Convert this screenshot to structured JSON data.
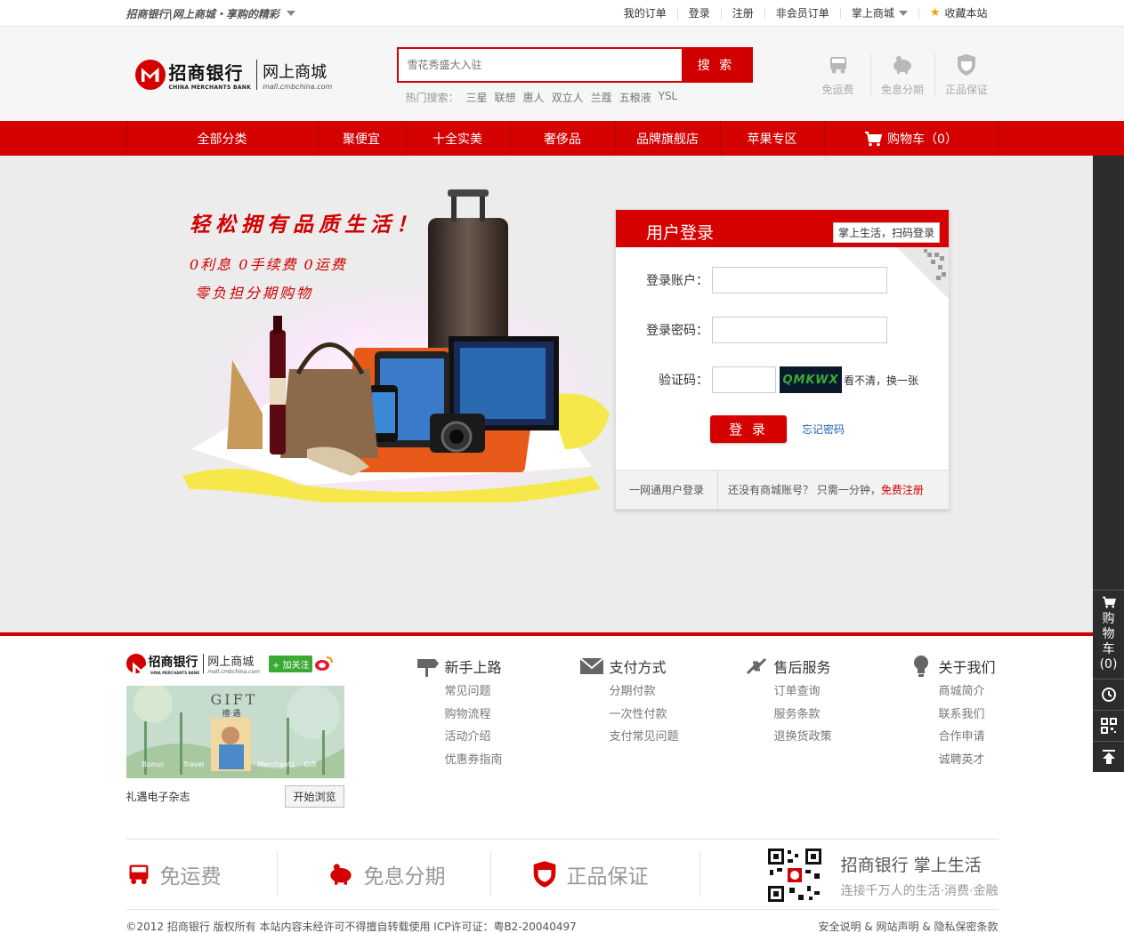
{
  "topbar": {
    "slogan": "招商银行|网上商城・享购的精彩",
    "links": [
      "我的订单",
      "登录",
      "注册",
      "非会员订单"
    ],
    "mobile_mall": "掌上商城",
    "bookmark": "收藏本站"
  },
  "header": {
    "logo_cn": "招商银行",
    "logo_en": "CHINA MERCHANTS BANK",
    "logo_sub_cn": "网上商城",
    "logo_sub_en": "mall.cmbchina.com",
    "search_placeholder": "雪花秀盛大入驻",
    "search_button": "搜 索",
    "hot_label": "热门搜索：",
    "hot_keywords": [
      "三星",
      "联想",
      "惠人",
      "双立人",
      "兰蔻",
      "五粮液",
      "YSL"
    ],
    "perks": [
      {
        "label": "免运费",
        "icon": "truck-icon"
      },
      {
        "label": "免息分期",
        "icon": "piggy-bank-icon"
      },
      {
        "label": "正品保证",
        "icon": "shield-icon"
      }
    ]
  },
  "nav": {
    "items": [
      "全部分类",
      "聚便宜",
      "十全实美",
      "奢侈品",
      "品牌旗舰店",
      "苹果专区"
    ],
    "cart_label": "购物车（0）"
  },
  "banner": {
    "headline": "轻松拥有品质生活！",
    "line2": "0利息  0手续费  0运费",
    "line3": "零负担分期购物"
  },
  "login": {
    "title": "用户登录",
    "scan_login": "掌上生活，扫码登录",
    "account_label": "登录账户：",
    "password_label": "登录密码：",
    "captcha_label": "验证码：",
    "captcha_text": "QMKWX",
    "refresh_captcha": "看不清，换一张",
    "submit": "登 录",
    "forgot": "忘记密码",
    "alt_login": "一网通用户登录",
    "no_account": "还没有商城账号？  只需一分钟，",
    "register": "免费注册"
  },
  "sidebar": {
    "cart": "购物车",
    "cart_count": "(0)"
  },
  "footer": {
    "follow": "+ 加关注",
    "magazine": {
      "gift_title": "GIFT",
      "gift_cn": "禮·遇",
      "words": [
        "Bonus",
        "Travel",
        "Merchants",
        "Gift"
      ],
      "caption": "礼遇电子杂志",
      "browse": "开始浏览"
    },
    "columns": [
      {
        "title": "新手上路",
        "icon": "signpost-icon",
        "items": [
          "常见问题",
          "购物流程",
          "活动介绍",
          "优惠券指南"
        ]
      },
      {
        "title": "支付方式",
        "icon": "envelope-icon",
        "items": [
          "分期付款",
          "一次性付款",
          "支付常见问题"
        ]
      },
      {
        "title": "售后服务",
        "icon": "exchange-arrows-icon",
        "items": [
          "订单查询",
          "服务条款",
          "退换货政策"
        ]
      },
      {
        "title": "关于我们",
        "icon": "lightbulb-icon",
        "items": [
          "商城简介",
          "联系我们",
          "合作申请",
          "诚聘英才"
        ]
      }
    ],
    "bottom_perks": [
      "免运费",
      "免息分期",
      "正品保证"
    ],
    "app_title": "招商银行  掌上生活",
    "app_subtitle": "连接千万人的生活·消费·金融",
    "copyright": "©2012 招商银行 版权所有 本站内容未经许可不得擅自转载使用 ICP许可证：粤B2-20040497",
    "legal": "安全说明 & 网站声明 & 隐私保密条款"
  },
  "colors": {
    "brand_red": "#d50000",
    "banner_bg": "#ececec",
    "link_blue": "#1b64b0"
  }
}
